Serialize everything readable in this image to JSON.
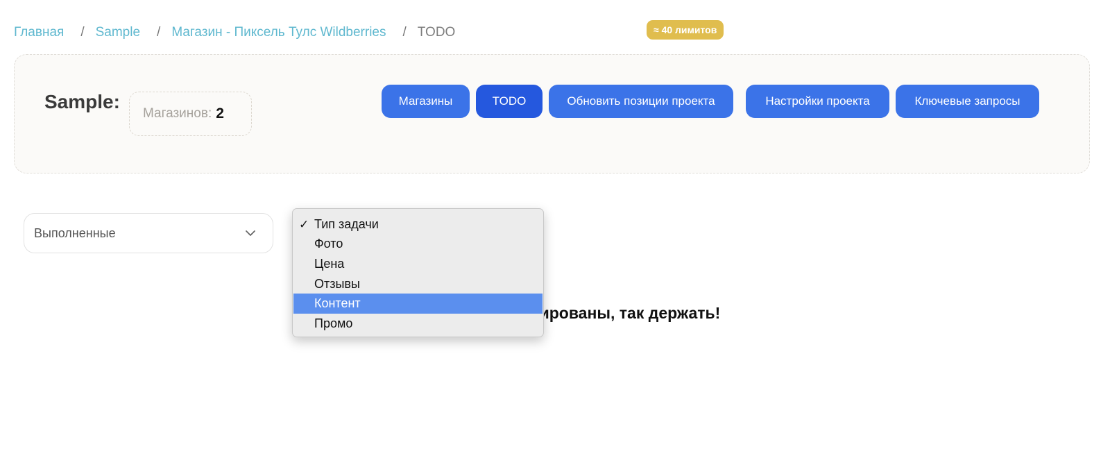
{
  "breadcrumb": {
    "items": [
      "Главная",
      "Sample",
      "Магазин - Пиксель Тулс Wildberries"
    ],
    "current": "TODO",
    "separator": "/"
  },
  "project": {
    "title": "Sample:",
    "stores_label": "Магазинов:",
    "stores_count": "2"
  },
  "toolbar": {
    "stores_button": "Магазины",
    "todo_button": "TODO",
    "update_button": "Обновить позиции проекта",
    "update_badge": "≈ 40 лимитов",
    "settings_button": "Настройки проекта",
    "keywords_button": "Ключевые запросы"
  },
  "filters": {
    "status_selected": "Выполненные",
    "task_type_options": [
      "Тип задачи",
      "Фото",
      "Цена",
      "Отзывы",
      "Контент",
      "Промо"
    ],
    "task_type_checked": "Тип задачи",
    "task_type_highlighted": "Контент"
  },
  "message": "оптимизированы, так держать!",
  "colors": {
    "link": "#5fb8cf",
    "button": "#3b73e8",
    "button_active": "#2558de",
    "badge": "#e0bd4e",
    "menu_highlight": "#5b8fee"
  },
  "icons": {
    "status_dropdown": "chevron-down-icon",
    "checked_option": "checkmark-icon"
  }
}
